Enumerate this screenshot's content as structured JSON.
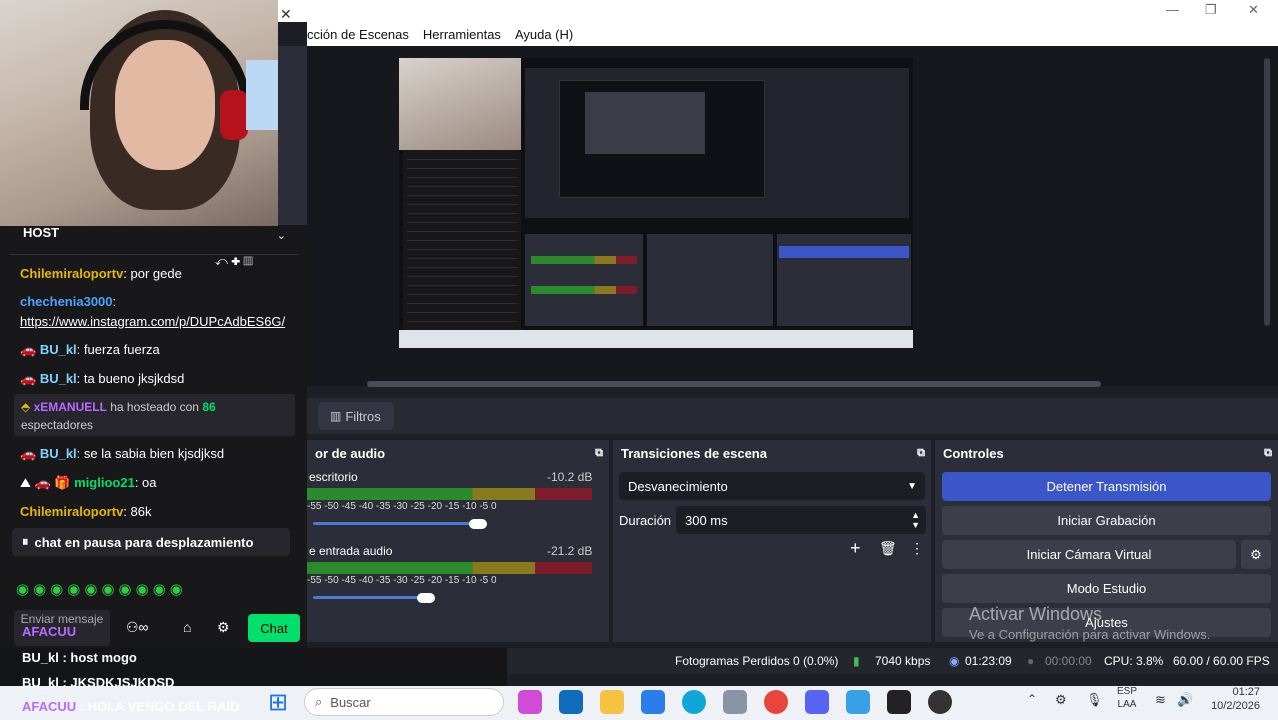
{
  "menu": {
    "items": [
      "cción de Escenas",
      "Herramientas",
      "Ayuda (H)"
    ]
  },
  "tabs": {
    "filters": "Filtros"
  },
  "audio": {
    "title": "or de audio",
    "channels": [
      {
        "name": "escritorio",
        "db": "-10.2 dB"
      },
      {
        "name": "e entrada audio",
        "db": "-21.2 dB"
      }
    ],
    "ticks": "-55  -50  -45  -40  -35  -30  -25  -20  -15  -10  -5   0"
  },
  "transitions": {
    "title": "Transiciones de escena",
    "selected": "Desvanecimiento",
    "duration_label": "Duración",
    "duration_value": "300 ms"
  },
  "controls": {
    "title": "Controles",
    "stop_stream": "Detener Transmisión",
    "start_recording": "Iniciar Grabación",
    "start_virtual_cam": "Iniciar Cámara Virtual",
    "studio_mode": "Modo Estudio",
    "settings": "Ajustes",
    "activate_title": "Activar Windows",
    "activate_sub": "Ve a Configuración para activar Windows."
  },
  "status": {
    "dropped": "Fotogramas Perdidos 0 (0.0%)",
    "kbps": "7040 kbps",
    "live_time": "01:23:09",
    "rec_time": "00:00:00",
    "cpu": "CPU: 3.8%",
    "fps": "60.00 / 60.00 FPS"
  },
  "chat": {
    "host_label": "HOST",
    "messages": [
      {
        "user": "Chilemiraloportv",
        "text": ": por gede",
        "color": "#e6b800"
      },
      {
        "user": "chechenia3000",
        "text": ":",
        "color": "#4aa3ff"
      },
      {
        "user": "",
        "text": "https://www.instagram.com/p/DUPcAdbES6G/",
        "color": "#ffffff"
      },
      {
        "user": "BU_kl",
        "text": ": fuerza fuerza",
        "color": "#7cd3ff"
      },
      {
        "user": "BU_kl",
        "text": ": ta bueno jksjkdsd",
        "color": "#7cd3ff"
      },
      {
        "user": "BU_kl",
        "text": ": se la sabia bien kjsdjksd",
        "color": "#7cd3ff"
      },
      {
        "user": "miglioo21",
        "text": ": oa",
        "color": "#00e06a"
      },
      {
        "user": "Chilemiraloportv",
        "text": ": 86k",
        "color": "#e6b800"
      }
    ],
    "raid": {
      "user": "xEMANUELL",
      "text": " ha hosteado con ",
      "count": "86",
      "tail": "espectadores"
    },
    "paused": "chat en pausa para desplazamiento",
    "send_placeholder": "Enviar mensaje",
    "send_button": "Chat"
  },
  "overlay": {
    "lines": [
      {
        "user": "AFACUU",
        "text": ""
      },
      {
        "user": "BU_kl",
        "text": " : host mogo"
      },
      {
        "user": "BU_kl",
        "text": " : JKSDKJSJKDSD"
      },
      {
        "user": "AFACUU",
        "text": " : HOLA VENGO DEL RAID"
      }
    ]
  },
  "taskbar": {
    "search_placeholder": "Buscar",
    "lang": "ESP",
    "lang2": "LAA",
    "time": "01:27",
    "date": "10/2/2026"
  },
  "colors": {
    "accent": "#3a56c9",
    "chat_send": "#00e06a",
    "obs_dock": "#2b2e38"
  }
}
